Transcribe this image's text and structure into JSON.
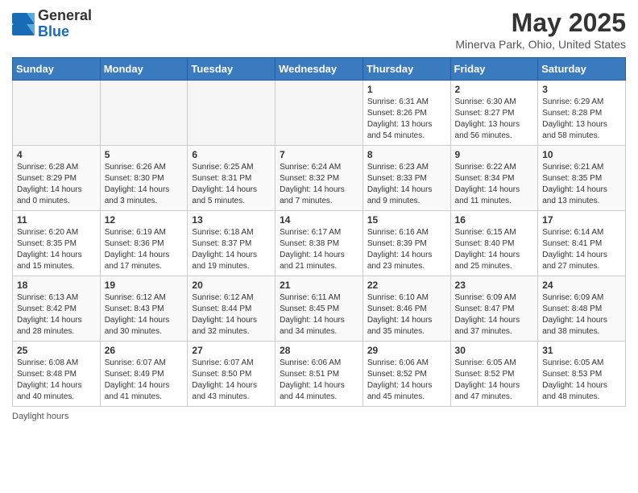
{
  "header": {
    "logo_general": "General",
    "logo_blue": "Blue",
    "month_title": "May 2025",
    "location": "Minerva Park, Ohio, United States"
  },
  "calendar": {
    "days_of_week": [
      "Sunday",
      "Monday",
      "Tuesday",
      "Wednesday",
      "Thursday",
      "Friday",
      "Saturday"
    ],
    "weeks": [
      [
        {
          "day": "",
          "sunrise": "",
          "sunset": "",
          "daylight": ""
        },
        {
          "day": "",
          "sunrise": "",
          "sunset": "",
          "daylight": ""
        },
        {
          "day": "",
          "sunrise": "",
          "sunset": "",
          "daylight": ""
        },
        {
          "day": "",
          "sunrise": "",
          "sunset": "",
          "daylight": ""
        },
        {
          "day": "1",
          "sunrise": "Sunrise: 6:31 AM",
          "sunset": "Sunset: 8:26 PM",
          "daylight": "Daylight: 13 hours and 54 minutes."
        },
        {
          "day": "2",
          "sunrise": "Sunrise: 6:30 AM",
          "sunset": "Sunset: 8:27 PM",
          "daylight": "Daylight: 13 hours and 56 minutes."
        },
        {
          "day": "3",
          "sunrise": "Sunrise: 6:29 AM",
          "sunset": "Sunset: 8:28 PM",
          "daylight": "Daylight: 13 hours and 58 minutes."
        }
      ],
      [
        {
          "day": "4",
          "sunrise": "Sunrise: 6:28 AM",
          "sunset": "Sunset: 8:29 PM",
          "daylight": "Daylight: 14 hours and 0 minutes."
        },
        {
          "day": "5",
          "sunrise": "Sunrise: 6:26 AM",
          "sunset": "Sunset: 8:30 PM",
          "daylight": "Daylight: 14 hours and 3 minutes."
        },
        {
          "day": "6",
          "sunrise": "Sunrise: 6:25 AM",
          "sunset": "Sunset: 8:31 PM",
          "daylight": "Daylight: 14 hours and 5 minutes."
        },
        {
          "day": "7",
          "sunrise": "Sunrise: 6:24 AM",
          "sunset": "Sunset: 8:32 PM",
          "daylight": "Daylight: 14 hours and 7 minutes."
        },
        {
          "day": "8",
          "sunrise": "Sunrise: 6:23 AM",
          "sunset": "Sunset: 8:33 PM",
          "daylight": "Daylight: 14 hours and 9 minutes."
        },
        {
          "day": "9",
          "sunrise": "Sunrise: 6:22 AM",
          "sunset": "Sunset: 8:34 PM",
          "daylight": "Daylight: 14 hours and 11 minutes."
        },
        {
          "day": "10",
          "sunrise": "Sunrise: 6:21 AM",
          "sunset": "Sunset: 8:35 PM",
          "daylight": "Daylight: 14 hours and 13 minutes."
        }
      ],
      [
        {
          "day": "11",
          "sunrise": "Sunrise: 6:20 AM",
          "sunset": "Sunset: 8:35 PM",
          "daylight": "Daylight: 14 hours and 15 minutes."
        },
        {
          "day": "12",
          "sunrise": "Sunrise: 6:19 AM",
          "sunset": "Sunset: 8:36 PM",
          "daylight": "Daylight: 14 hours and 17 minutes."
        },
        {
          "day": "13",
          "sunrise": "Sunrise: 6:18 AM",
          "sunset": "Sunset: 8:37 PM",
          "daylight": "Daylight: 14 hours and 19 minutes."
        },
        {
          "day": "14",
          "sunrise": "Sunrise: 6:17 AM",
          "sunset": "Sunset: 8:38 PM",
          "daylight": "Daylight: 14 hours and 21 minutes."
        },
        {
          "day": "15",
          "sunrise": "Sunrise: 6:16 AM",
          "sunset": "Sunset: 8:39 PM",
          "daylight": "Daylight: 14 hours and 23 minutes."
        },
        {
          "day": "16",
          "sunrise": "Sunrise: 6:15 AM",
          "sunset": "Sunset: 8:40 PM",
          "daylight": "Daylight: 14 hours and 25 minutes."
        },
        {
          "day": "17",
          "sunrise": "Sunrise: 6:14 AM",
          "sunset": "Sunset: 8:41 PM",
          "daylight": "Daylight: 14 hours and 27 minutes."
        }
      ],
      [
        {
          "day": "18",
          "sunrise": "Sunrise: 6:13 AM",
          "sunset": "Sunset: 8:42 PM",
          "daylight": "Daylight: 14 hours and 28 minutes."
        },
        {
          "day": "19",
          "sunrise": "Sunrise: 6:12 AM",
          "sunset": "Sunset: 8:43 PM",
          "daylight": "Daylight: 14 hours and 30 minutes."
        },
        {
          "day": "20",
          "sunrise": "Sunrise: 6:12 AM",
          "sunset": "Sunset: 8:44 PM",
          "daylight": "Daylight: 14 hours and 32 minutes."
        },
        {
          "day": "21",
          "sunrise": "Sunrise: 6:11 AM",
          "sunset": "Sunset: 8:45 PM",
          "daylight": "Daylight: 14 hours and 34 minutes."
        },
        {
          "day": "22",
          "sunrise": "Sunrise: 6:10 AM",
          "sunset": "Sunset: 8:46 PM",
          "daylight": "Daylight: 14 hours and 35 minutes."
        },
        {
          "day": "23",
          "sunrise": "Sunrise: 6:09 AM",
          "sunset": "Sunset: 8:47 PM",
          "daylight": "Daylight: 14 hours and 37 minutes."
        },
        {
          "day": "24",
          "sunrise": "Sunrise: 6:09 AM",
          "sunset": "Sunset: 8:48 PM",
          "daylight": "Daylight: 14 hours and 38 minutes."
        }
      ],
      [
        {
          "day": "25",
          "sunrise": "Sunrise: 6:08 AM",
          "sunset": "Sunset: 8:48 PM",
          "daylight": "Daylight: 14 hours and 40 minutes."
        },
        {
          "day": "26",
          "sunrise": "Sunrise: 6:07 AM",
          "sunset": "Sunset: 8:49 PM",
          "daylight": "Daylight: 14 hours and 41 minutes."
        },
        {
          "day": "27",
          "sunrise": "Sunrise: 6:07 AM",
          "sunset": "Sunset: 8:50 PM",
          "daylight": "Daylight: 14 hours and 43 minutes."
        },
        {
          "day": "28",
          "sunrise": "Sunrise: 6:06 AM",
          "sunset": "Sunset: 8:51 PM",
          "daylight": "Daylight: 14 hours and 44 minutes."
        },
        {
          "day": "29",
          "sunrise": "Sunrise: 6:06 AM",
          "sunset": "Sunset: 8:52 PM",
          "daylight": "Daylight: 14 hours and 45 minutes."
        },
        {
          "day": "30",
          "sunrise": "Sunrise: 6:05 AM",
          "sunset": "Sunset: 8:52 PM",
          "daylight": "Daylight: 14 hours and 47 minutes."
        },
        {
          "day": "31",
          "sunrise": "Sunrise: 6:05 AM",
          "sunset": "Sunset: 8:53 PM",
          "daylight": "Daylight: 14 hours and 48 minutes."
        }
      ]
    ]
  },
  "footer": {
    "note": "Daylight hours"
  }
}
